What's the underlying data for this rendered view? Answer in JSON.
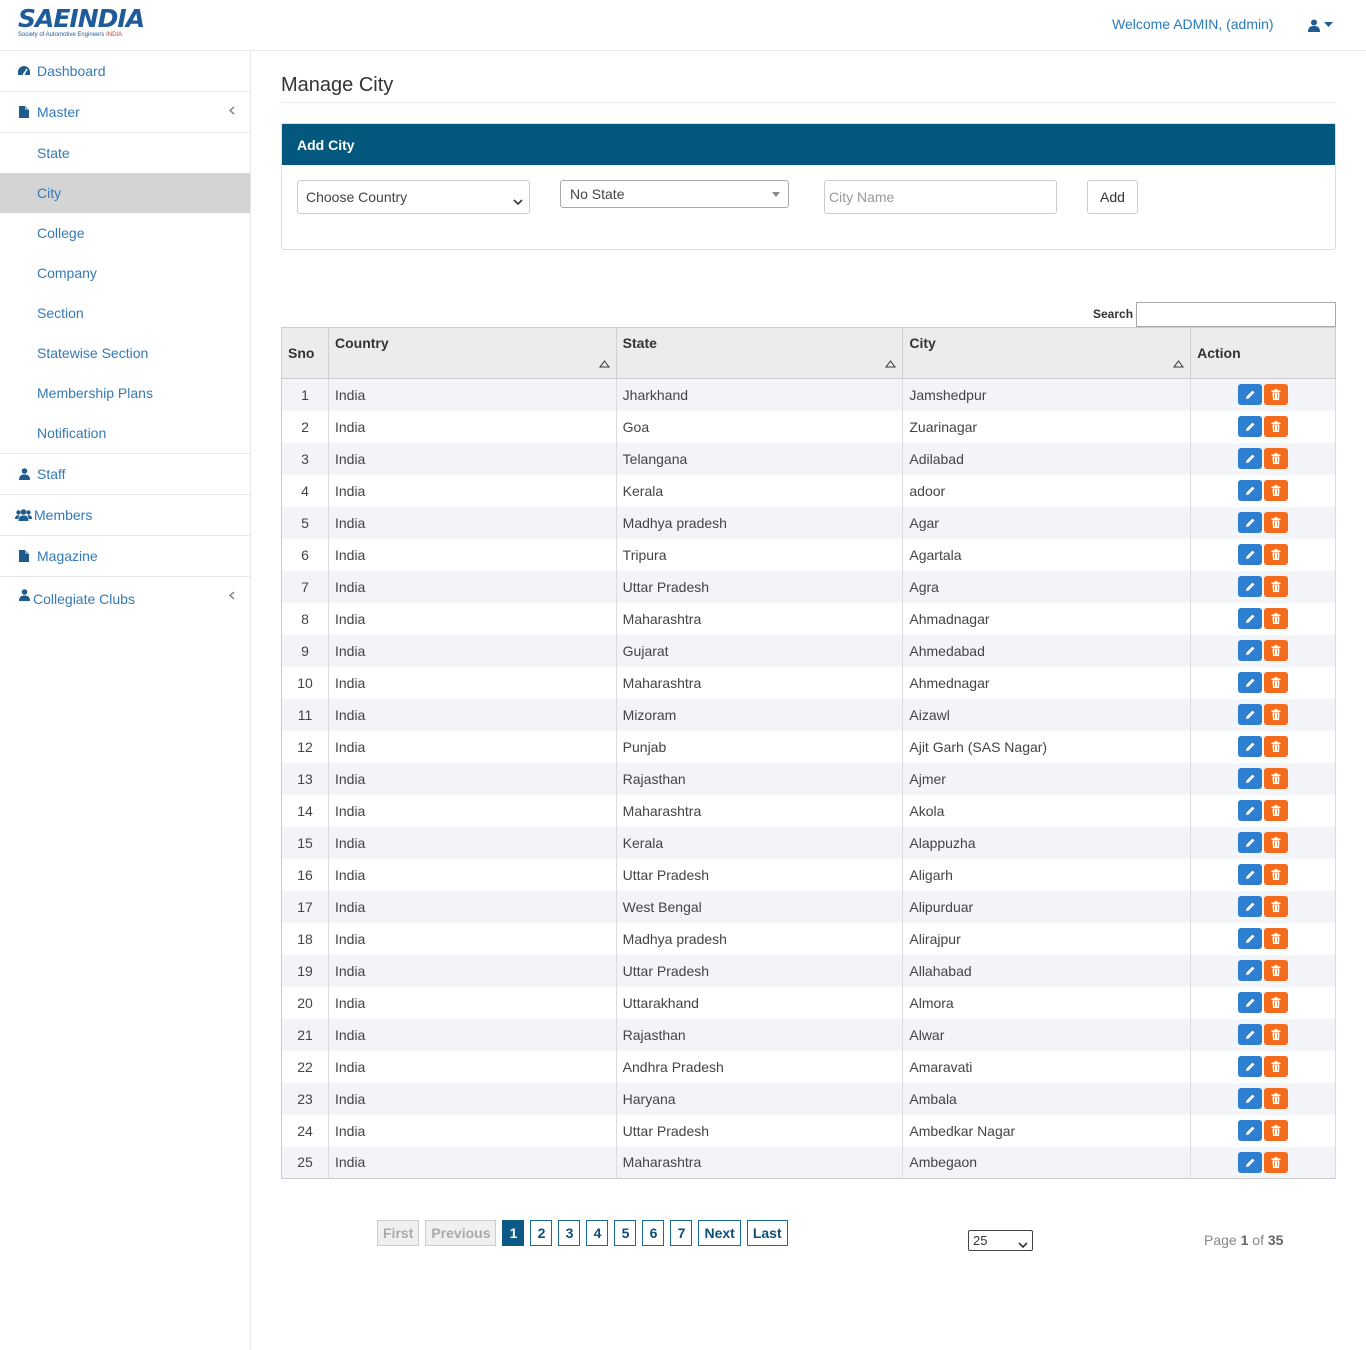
{
  "header": {
    "logo_text": "SAEINDIA",
    "logo_subtext": "Society of Automotive Engineers",
    "logo_subtext_accent": "INDIA",
    "welcome": "Welcome ADMIN, (admin)"
  },
  "sidebar": {
    "dashboard": "Dashboard",
    "master": "Master",
    "master_items": [
      "State",
      "City",
      "College",
      "Company",
      "Section",
      "Statewise Section",
      "Membership Plans",
      "Notification"
    ],
    "active_item": "City",
    "staff": "Staff",
    "members": "Members",
    "magazine": "Magazine",
    "collegiate_clubs": "Collegiate Clubs"
  },
  "main": {
    "title": "Manage City",
    "add_panel": {
      "heading": "Add City",
      "country_select": "Choose Country",
      "state_select": "No State",
      "city_placeholder": "City Name",
      "add_button": "Add"
    },
    "search_label": "Search",
    "table": {
      "columns": [
        "Sno",
        "Country",
        "State",
        "City",
        "Action"
      ],
      "rows": [
        [
          "1",
          "India",
          "Jharkhand",
          "Jamshedpur"
        ],
        [
          "2",
          "India",
          "Goa",
          "Zuarinagar"
        ],
        [
          "3",
          "India",
          "Telangana",
          "Adilabad"
        ],
        [
          "4",
          "India",
          "Kerala",
          "adoor"
        ],
        [
          "5",
          "India",
          "Madhya pradesh",
          "Agar"
        ],
        [
          "6",
          "India",
          "Tripura",
          "Agartala"
        ],
        [
          "7",
          "India",
          "Uttar Pradesh",
          "Agra"
        ],
        [
          "8",
          "India",
          "Maharashtra",
          "Ahmadnagar"
        ],
        [
          "9",
          "India",
          "Gujarat",
          "Ahmedabad"
        ],
        [
          "10",
          "India",
          "Maharashtra",
          "Ahmednagar"
        ],
        [
          "11",
          "India",
          "Mizoram",
          "Aizawl"
        ],
        [
          "12",
          "India",
          "Punjab",
          "Ajit Garh (SAS Nagar)"
        ],
        [
          "13",
          "India",
          "Rajasthan",
          "Ajmer"
        ],
        [
          "14",
          "India",
          "Maharashtra",
          "Akola"
        ],
        [
          "15",
          "India",
          "Kerala",
          "Alappuzha"
        ],
        [
          "16",
          "India",
          "Uttar Pradesh",
          "Aligarh"
        ],
        [
          "17",
          "India",
          "West Bengal",
          "Alipurduar"
        ],
        [
          "18",
          "India",
          "Madhya pradesh",
          "Alirajpur"
        ],
        [
          "19",
          "India",
          "Uttar Pradesh",
          "Allahabad"
        ],
        [
          "20",
          "India",
          "Uttarakhand",
          "Almora"
        ],
        [
          "21",
          "India",
          "Rajasthan",
          "Alwar"
        ],
        [
          "22",
          "India",
          "Andhra Pradesh",
          "Amaravati"
        ],
        [
          "23",
          "India",
          "Haryana",
          "Ambala"
        ],
        [
          "24",
          "India",
          "Uttar Pradesh",
          "Ambedkar Nagar"
        ],
        [
          "25",
          "India",
          "Maharashtra",
          "Ambegaon"
        ]
      ]
    },
    "pagination": {
      "first": "First",
      "previous": "Previous",
      "pages": [
        "1",
        "2",
        "3",
        "4",
        "5",
        "6",
        "7"
      ],
      "current_page": "1",
      "next": "Next",
      "last": "Last",
      "page_size": "25",
      "page_word": "Page",
      "of_word": "of",
      "total_pages": "35"
    }
  },
  "colors": {
    "accent": "#04587e",
    "link": "#337ab7",
    "edit_button": "#2f7fd1",
    "delete_button": "#f36b1c"
  }
}
